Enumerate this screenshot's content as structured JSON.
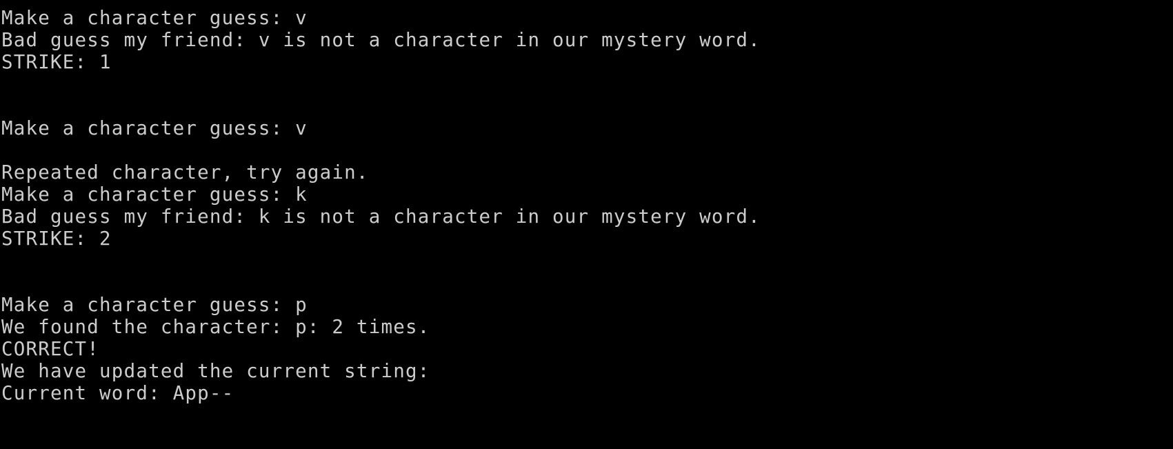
{
  "console": {
    "lines": [
      "Make a character guess: v",
      "Bad guess my friend: v is not a character in our mystery word.",
      "STRIKE: 1",
      "",
      "",
      "Make a character guess: v",
      "",
      "Repeated character, try again.",
      "Make a character guess: k",
      "Bad guess my friend: k is not a character in our mystery word.",
      "STRIKE: 2",
      "",
      "",
      "Make a character guess: p",
      "We found the character: p: 2 times.",
      "CORRECT!",
      "We have updated the current string:",
      "Current word: App--"
    ]
  },
  "colors": {
    "background": "#000000",
    "text": "#cccccc"
  }
}
